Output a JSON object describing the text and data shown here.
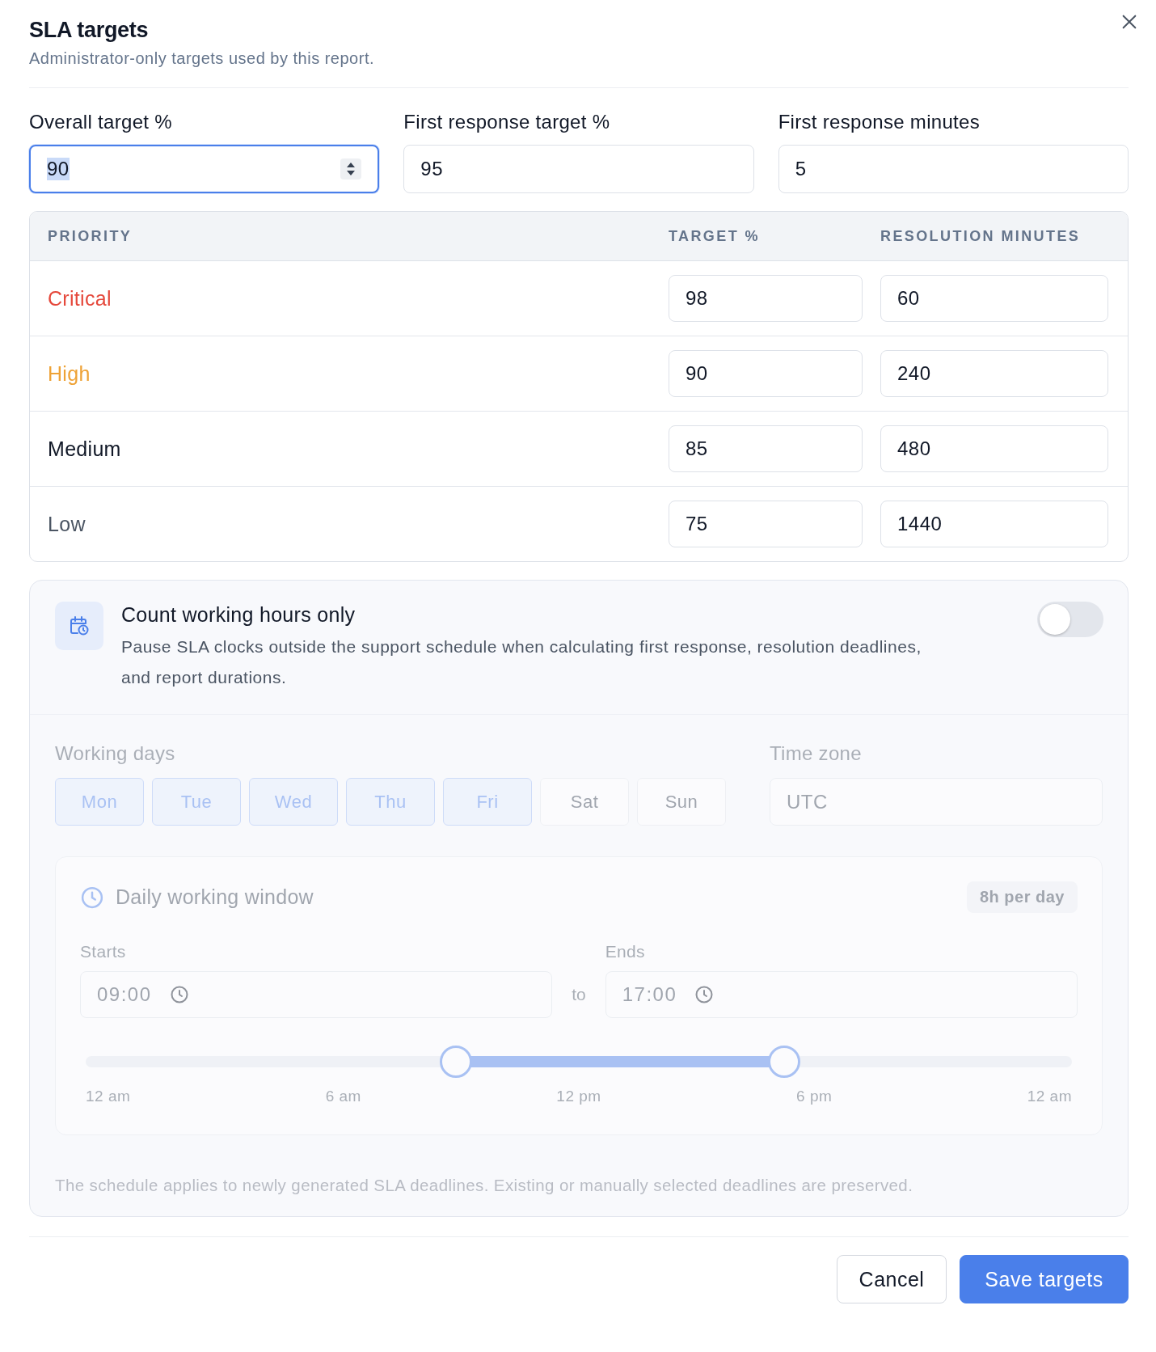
{
  "dialog": {
    "title": "SLA targets",
    "subtitle": "Administrator-only targets used by this report."
  },
  "fields": [
    {
      "label": "Overall target %",
      "value": "90",
      "focused": true
    },
    {
      "label": "First response target %",
      "value": "95",
      "focused": false
    },
    {
      "label": "First response minutes",
      "value": "5",
      "focused": false
    }
  ],
  "priority_table": {
    "columns": [
      "PRIORITY",
      "TARGET %",
      "RESOLUTION MINUTES"
    ],
    "rows": [
      {
        "priority": "Critical",
        "color": "#e5483b",
        "target": "98",
        "resolution": "60"
      },
      {
        "priority": "High",
        "color": "#eea236",
        "target": "90",
        "resolution": "240"
      },
      {
        "priority": "Medium",
        "color": "#111827",
        "target": "85",
        "resolution": "480"
      },
      {
        "priority": "Low",
        "color": "#4b5563",
        "target": "75",
        "resolution": "1440"
      }
    ]
  },
  "working_hours": {
    "title": "Count working hours only",
    "description": "Pause SLA clocks outside the support schedule when calculating first response, resolution deadlines, and report durations.",
    "on": false,
    "schedule": {
      "disabled": true,
      "days_label": "Working days",
      "days": [
        {
          "label": "Mon",
          "selected": true
        },
        {
          "label": "Tue",
          "selected": true
        },
        {
          "label": "Wed",
          "selected": true
        },
        {
          "label": "Thu",
          "selected": true
        },
        {
          "label": "Fri",
          "selected": true
        },
        {
          "label": "Sat",
          "selected": false
        },
        {
          "label": "Sun",
          "selected": false
        }
      ],
      "time_zone_label": "Time zone",
      "time_zone": "UTC",
      "window": {
        "title": "Daily working window",
        "badge": "8h per day",
        "starts_label": "Starts",
        "starts": "09:00",
        "separator": "to",
        "ends_label": "Ends",
        "ends": "17:00",
        "slider": {
          "thumbs": [
            {
              "level": 0.375
            },
            {
              "level": 0.7083
            }
          ],
          "ticks": [
            "12 am",
            "6 am",
            "12 pm",
            "6 pm",
            "12 am"
          ]
        }
      },
      "note": "The schedule applies to newly generated SLA deadlines. Existing or manually selected deadlines are preserved."
    }
  },
  "buttons": [
    {
      "label": "Cancel",
      "kind": "secondary"
    },
    {
      "label": "Save targets",
      "kind": "primary"
    }
  ]
}
